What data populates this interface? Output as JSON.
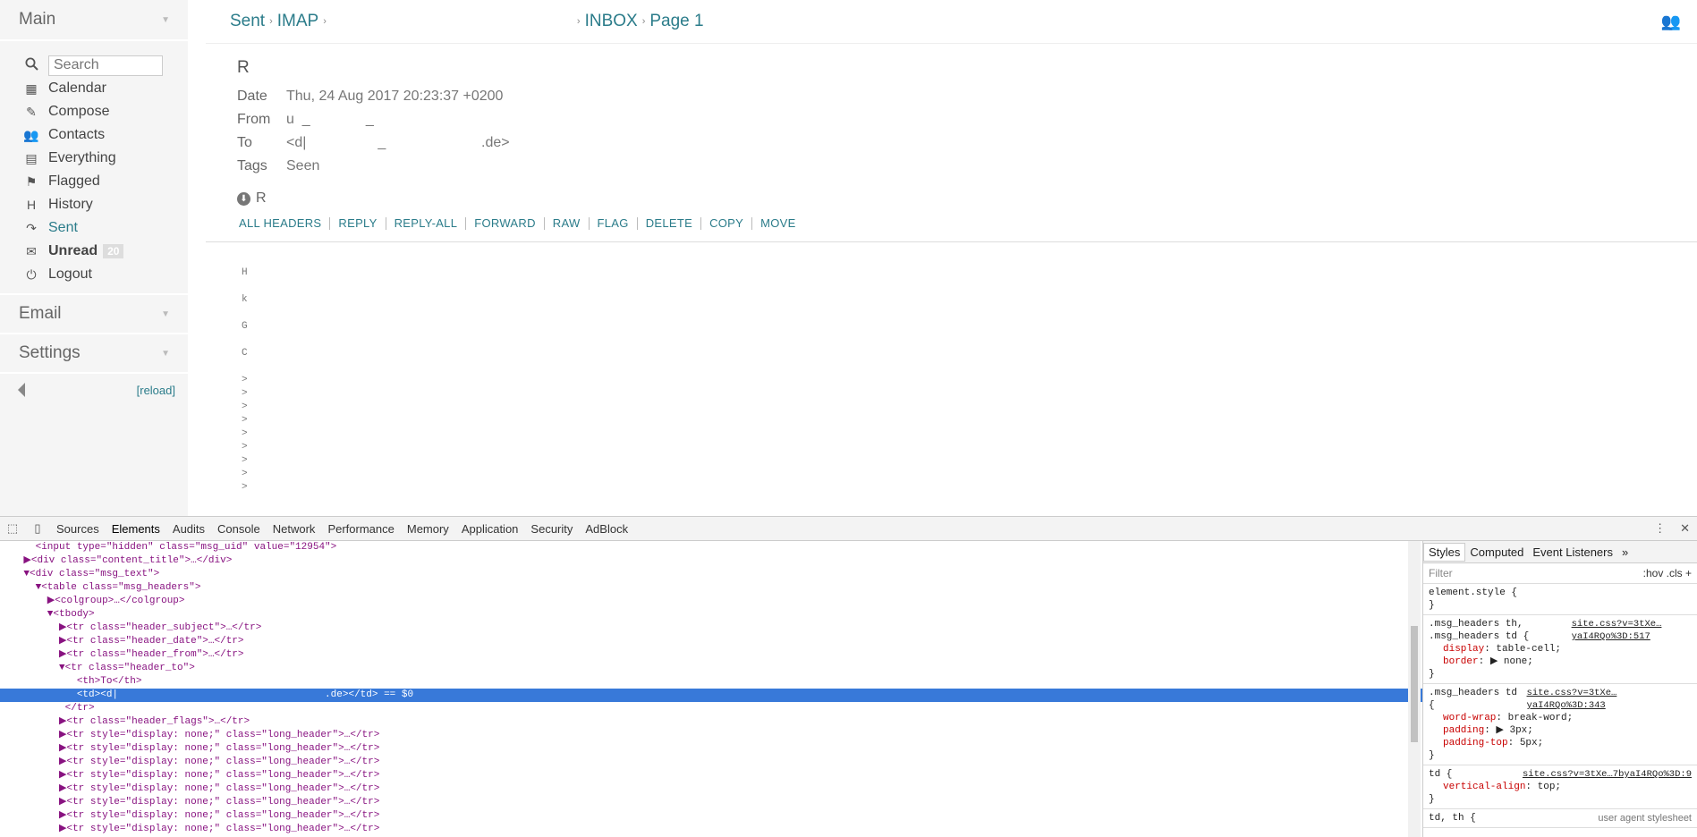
{
  "sidebar": {
    "main_title": "Main",
    "search_placeholder": "Search",
    "items": [
      {
        "label": "Calendar",
        "icon": "calendar-icon"
      },
      {
        "label": "Compose",
        "icon": "compose-icon"
      },
      {
        "label": "Contacts",
        "icon": "contacts-icon"
      },
      {
        "label": "Everything",
        "icon": "box-icon"
      },
      {
        "label": "Flagged",
        "icon": "flag-icon"
      },
      {
        "label": "History",
        "icon": "history-icon"
      },
      {
        "label": "Sent",
        "icon": "sent-icon"
      },
      {
        "label": "Unread",
        "icon": "envelope-icon",
        "badge": "20"
      },
      {
        "label": "Logout",
        "icon": "power-icon"
      }
    ],
    "email_title": "Email",
    "settings_title": "Settings",
    "reload_label": "[reload]"
  },
  "breadcrumb": {
    "sent": "Sent",
    "imap": "IMAP",
    "inbox": "INBOX",
    "page": "Page 1"
  },
  "message": {
    "subject": "R",
    "headers": [
      {
        "key": "Date",
        "value": "Thu, 24 Aug 2017 20:23:37 +0200"
      },
      {
        "key": "From",
        "value": "u  _              _"
      },
      {
        "key": "To",
        "value": "<d|                  _                        .de>"
      },
      {
        "key": "Tags",
        "value": "Seen"
      }
    ],
    "attachment_label": "R",
    "actions": [
      "ALL HEADERS",
      "REPLY",
      "REPLY-ALL",
      "FORWARD",
      "RAW",
      "FLAG",
      "DELETE",
      "COPY",
      "MOVE"
    ],
    "body_lines": [
      "H",
      "k",
      "G",
      "C"
    ],
    "quote_marks": [
      ">",
      ">",
      ">",
      ">",
      ">",
      ">",
      ">",
      ">",
      ">"
    ]
  },
  "devtools": {
    "tabs": [
      "Sources",
      "Elements",
      "Audits",
      "Console",
      "Network",
      "Performance",
      "Memory",
      "Application",
      "Security",
      "AdBlock"
    ],
    "active_tab": "Elements",
    "styles_tabs": [
      "Styles",
      "Computed",
      "Event Listeners"
    ],
    "filter_placeholder": "Filter",
    "filter_opts": ":hov  .cls  +",
    "dom_lines": [
      "    <input type=\"hidden\" class=\"msg_uid\" value=\"12954\">",
      "  ▶<div class=\"content_title\">…</div>",
      "  ▼<div class=\"msg_text\">",
      "    ▼<table class=\"msg_headers\">",
      "      ▶<colgroup>…</colgroup>",
      "      ▼<tbody>",
      "        ▶<tr class=\"header_subject\">…</tr>",
      "        ▶<tr class=\"header_date\">…</tr>",
      "        ▶<tr class=\"header_from\">…</tr>",
      "        ▼<tr class=\"header_to\">",
      "           <th>To</th>",
      "           <td><d|                                   .de></td> == $0",
      "         </tr>",
      "        ▶<tr class=\"header_flags\">…</tr>",
      "        ▶<tr style=\"display: none;\" class=\"long_header\">…</tr>",
      "        ▶<tr style=\"display: none;\" class=\"long_header\">…</tr>",
      "        ▶<tr style=\"display: none;\" class=\"long_header\">…</tr>",
      "        ▶<tr style=\"display: none;\" class=\"long_header\">…</tr>",
      "        ▶<tr style=\"display: none;\" class=\"long_header\">…</tr>",
      "        ▶<tr style=\"display: none;\" class=\"long_header\">…</tr>",
      "        ▶<tr style=\"display: none;\" class=\"long_header\">…</tr>",
      "        ▶<tr style=\"display: none;\" class=\"long_header\">…</tr>",
      "        ▶<tr style=\"display: none;\" class=\"long_header\">…</tr>"
    ],
    "selected_line": 11,
    "rules": [
      {
        "selector": "element.style {",
        "source": "",
        "props": [],
        "close": "}"
      },
      {
        "selector": ".msg_headers th, .msg_headers td {",
        "source": "site.css?v=3tXe…yaI4RQo%3D:517",
        "props": [
          [
            "display",
            "table-cell;"
          ],
          [
            "border",
            "▶ none;"
          ]
        ],
        "close": "}"
      },
      {
        "selector": ".msg_headers td {",
        "source": "site.css?v=3tXe…yaI4RQo%3D:343",
        "props": [
          [
            "word-wrap",
            "break-word;"
          ],
          [
            "padding",
            "▶ 3px;"
          ],
          [
            "padding-top",
            "5px;"
          ]
        ],
        "close": "}"
      },
      {
        "selector": "td {",
        "source": "site.css?v=3tXe…7byaI4RQo%3D:9",
        "props": [
          [
            "vertical-align",
            "top;"
          ]
        ],
        "close": "}"
      },
      {
        "selector": "td, th {",
        "source": "user agent stylesheet",
        "props": [],
        "close": ""
      }
    ]
  },
  "colors": {
    "accent": "#2b7c8a",
    "selection": "#3879d9"
  }
}
